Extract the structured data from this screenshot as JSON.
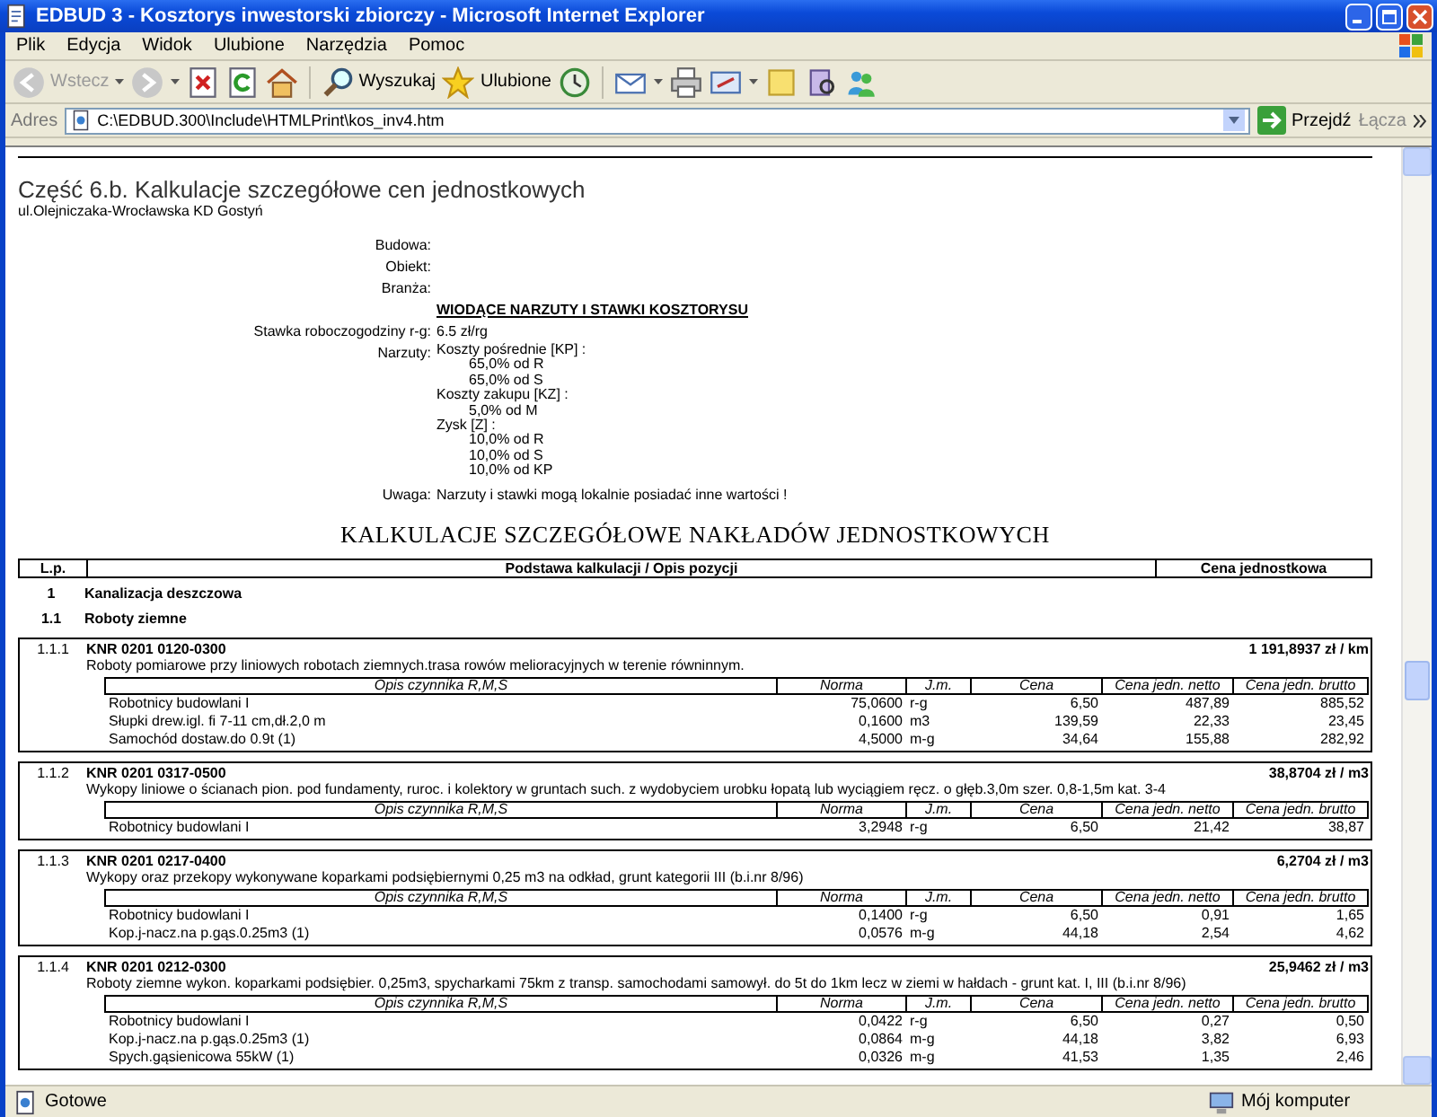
{
  "window": {
    "title": "EDBUD 3 - Kosztorys inwestorski zbiorczy - Microsoft Internet Explorer"
  },
  "menu": [
    "Plik",
    "Edycja",
    "Widok",
    "Ulubione",
    "Narzędzia",
    "Pomoc"
  ],
  "toolbar": {
    "back": {
      "label": "Wstecz",
      "disabled": true
    },
    "search": "Wyszukaj",
    "favorites": "Ulubione"
  },
  "address_bar": {
    "label": "Adres",
    "value": "C:\\EDBUD.300\\Include\\HTMLPrint\\kos_inv4.htm",
    "go": "Przejdź",
    "links": "Łącza"
  },
  "document": {
    "heading": "Część 6.b. Kalkulacje szczegółowe cen jednostkowych",
    "subtitle": "ul.Olejniczaka-Wrocławska KD Gostyń",
    "info": [
      {
        "label": "Budowa:"
      },
      {
        "label": "Obiekt:"
      },
      {
        "label": "Branża:"
      }
    ],
    "rates_title": "WIODĄCE NARZUTY I STAWKI KOSZTORYSU",
    "rate": {
      "label": "Stawka roboczogodziny r-g:",
      "value": "6.5 zł/rg"
    },
    "surcharges": {
      "label": "Narzuty:",
      "items": [
        {
          "name": "Koszty pośrednie [KP] :",
          "children": [
            "65,0% od R",
            "65,0% od S"
          ]
        },
        {
          "name": "Koszty zakupu [KZ] :",
          "children": [
            "5,0% od M"
          ]
        },
        {
          "name": "Zysk [Z] :",
          "children": [
            "10,0% od R",
            "10,0% od S",
            "10,0% od KP"
          ]
        }
      ]
    },
    "note": {
      "label": "Uwaga:",
      "value": "Narzuty i stawki mogą lokalnie posiadać inne wartości !"
    },
    "main_title": "KALKULACJE SZCZEGÓŁOWE NAKŁADÓW JEDNOSTKOWYCH",
    "columns": [
      "L.p.",
      "Podstawa kalkulacji / Opis pozycji",
      "Cena jednostkowa"
    ],
    "rows": [
      {
        "kind": "section",
        "lp": "1",
        "title": "Kanalizacja deszczowa"
      },
      {
        "kind": "section",
        "lp": "1.1",
        "title": "Roboty ziemne"
      },
      {
        "kind": "position",
        "lp": "1.1.1",
        "code": "KNR 0201 0120-0300",
        "price": "1 191,8937 zł / km",
        "description": "Roboty pomiarowe przy liniowych robotach ziemnych.trasa rowów melioracyjnych w terenie równinnym.",
        "factor_columns": [
          "Opis czynnika R,M,S",
          "Norma",
          "J.m.",
          "Cena",
          "Cena jedn. netto",
          "Cena jedn. brutto"
        ],
        "factors": [
          [
            "Robotnicy budowlani I",
            "75,0600",
            "r-g",
            "6,50",
            "487,89",
            "885,52"
          ],
          [
            "Słupki drew.igl. fi 7-11 cm,dł.2,0 m",
            "0,1600",
            "m3",
            "139,59",
            "22,33",
            "23,45"
          ],
          [
            "Samochód dostaw.do 0.9t (1)",
            "4,5000",
            "m-g",
            "34,64",
            "155,88",
            "282,92"
          ]
        ]
      },
      {
        "kind": "position",
        "lp": "1.1.2",
        "code": "KNR 0201 0317-0500",
        "price": "38,8704 zł / m3",
        "description": "Wykopy liniowe o ścianach pion. pod fundamenty, ruroc. i kolektory w gruntach such. z wydobyciem urobku łopatą lub wyciągiem ręcz. o głęb.3,0m szer. 0,8-1,5m kat. 3-4",
        "factor_columns": [
          "Opis czynnika R,M,S",
          "Norma",
          "J.m.",
          "Cena",
          "Cena jedn. netto",
          "Cena jedn. brutto"
        ],
        "factors": [
          [
            "Robotnicy budowlani I",
            "3,2948",
            "r-g",
            "6,50",
            "21,42",
            "38,87"
          ]
        ]
      },
      {
        "kind": "position",
        "lp": "1.1.3",
        "code": "KNR 0201 0217-0400",
        "price": "6,2704 zł / m3",
        "description": "Wykopy oraz przekopy wykonywane koparkami podsiębiernymi 0,25 m3 na odkład, grunt kategorii III (b.i.nr 8/96)",
        "factor_columns": [
          "Opis czynnika R,M,S",
          "Norma",
          "J.m.",
          "Cena",
          "Cena jedn. netto",
          "Cena jedn. brutto"
        ],
        "factors": [
          [
            "Robotnicy budowlani I",
            "0,1400",
            "r-g",
            "6,50",
            "0,91",
            "1,65"
          ],
          [
            "Kop.j-nacz.na p.gąs.0.25m3 (1)",
            "0,0576",
            "m-g",
            "44,18",
            "2,54",
            "4,62"
          ]
        ]
      },
      {
        "kind": "position",
        "lp": "1.1.4",
        "code": "KNR 0201 0212-0300",
        "price": "25,9462 zł / m3",
        "description": "Roboty ziemne wykon. koparkami podsiębier. 0,25m3, spycharkami 75km z transp. samochodami samowył. do 5t do 1km lecz w ziemi w hałdach - grunt kat. I, III (b.i.nr 8/96)",
        "factor_columns": [
          "Opis czynnika R,M,S",
          "Norma",
          "J.m.",
          "Cena",
          "Cena jedn. netto",
          "Cena jedn. brutto"
        ],
        "factors": [
          [
            "Robotnicy budowlani I",
            "0,0422",
            "r-g",
            "6,50",
            "0,27",
            "0,50"
          ],
          [
            "Kop.j-nacz.na p.gąs.0.25m3 (1)",
            "0,0864",
            "m-g",
            "44,18",
            "3,82",
            "6,93"
          ],
          [
            "Spych.gąsienicowa 55kW (1)",
            "0,0326",
            "m-g",
            "41,53",
            "1,35",
            "2,46"
          ]
        ]
      }
    ]
  },
  "status_bar": {
    "text": "Gotowe",
    "zone": "Mój komputer"
  }
}
